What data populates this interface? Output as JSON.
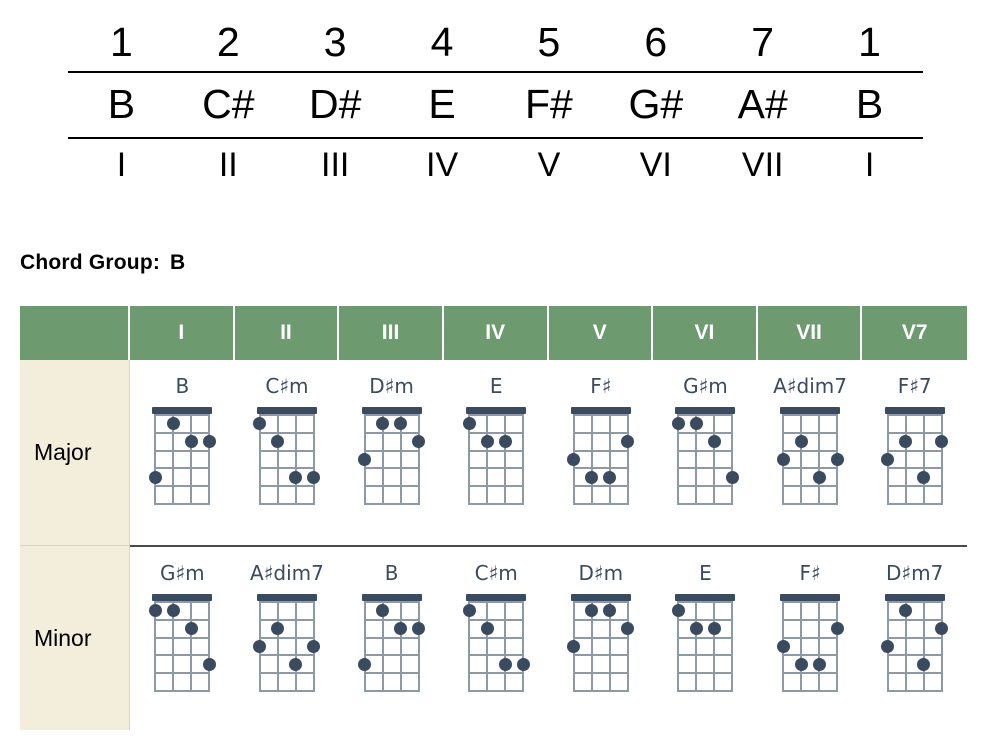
{
  "scale_table": {
    "degrees_label": "scale degrees",
    "degrees": [
      "1",
      "2",
      "3",
      "4",
      "5",
      "6",
      "7",
      "1"
    ],
    "notes": [
      "B",
      "C#",
      "D#",
      "E",
      "F#",
      "G#",
      "A#",
      "B"
    ],
    "numerals": [
      "I",
      "II",
      "III",
      "IV",
      "V",
      "VI",
      "VII",
      "I"
    ]
  },
  "chord_group": {
    "label": "Chord Group:",
    "value": "B"
  },
  "chord_table": {
    "header_accent_color": "#6E9A70",
    "row_label_color": "#F3EEDC",
    "diagram_color": "#3B4B5F",
    "corner_label": "",
    "columns": [
      "I",
      "II",
      "III",
      "IV",
      "V",
      "VI",
      "VII",
      "V7"
    ],
    "rows": [
      {
        "label": "Major",
        "chords": [
          {
            "name": "B",
            "dots": [
              [
                2,
                1
              ],
              [
                3,
                2
              ],
              [
                4,
                2
              ],
              [
                1,
                4
              ]
            ]
          },
          {
            "name": "C♯m",
            "dots": [
              [
                1,
                1
              ],
              [
                2,
                2
              ],
              [
                3,
                4
              ],
              [
                4,
                4
              ]
            ]
          },
          {
            "name": "D♯m",
            "dots": [
              [
                2,
                1
              ],
              [
                3,
                1
              ],
              [
                4,
                2
              ],
              [
                1,
                3
              ]
            ]
          },
          {
            "name": "E",
            "dots": [
              [
                1,
                1
              ],
              [
                2,
                2
              ],
              [
                3,
                2
              ]
            ]
          },
          {
            "name": "F♯",
            "dots": [
              [
                4,
                2
              ],
              [
                1,
                3
              ],
              [
                2,
                4
              ],
              [
                3,
                4
              ]
            ]
          },
          {
            "name": "G♯m",
            "dots": [
              [
                1,
                1
              ],
              [
                2,
                1
              ],
              [
                3,
                2
              ],
              [
                4,
                4
              ]
            ]
          },
          {
            "name": "A♯dim7",
            "dots": [
              [
                2,
                2
              ],
              [
                1,
                3
              ],
              [
                4,
                3
              ],
              [
                3,
                4
              ]
            ]
          },
          {
            "name": "F♯7",
            "dots": [
              [
                2,
                2
              ],
              [
                4,
                2
              ],
              [
                1,
                3
              ],
              [
                3,
                4
              ]
            ]
          }
        ]
      },
      {
        "label": "Minor",
        "chords": [
          {
            "name": "G♯m",
            "dots": [
              [
                1,
                1
              ],
              [
                2,
                1
              ],
              [
                3,
                2
              ],
              [
                4,
                4
              ]
            ]
          },
          {
            "name": "A♯dim7",
            "dots": [
              [
                2,
                2
              ],
              [
                1,
                3
              ],
              [
                4,
                3
              ],
              [
                3,
                4
              ]
            ]
          },
          {
            "name": "B",
            "dots": [
              [
                2,
                1
              ],
              [
                3,
                2
              ],
              [
                4,
                2
              ],
              [
                1,
                4
              ]
            ]
          },
          {
            "name": "C♯m",
            "dots": [
              [
                1,
                1
              ],
              [
                2,
                2
              ],
              [
                3,
                4
              ],
              [
                4,
                4
              ]
            ]
          },
          {
            "name": "D♯m",
            "dots": [
              [
                2,
                1
              ],
              [
                3,
                1
              ],
              [
                4,
                2
              ],
              [
                1,
                3
              ]
            ]
          },
          {
            "name": "E",
            "dots": [
              [
                1,
                1
              ],
              [
                2,
                2
              ],
              [
                3,
                2
              ]
            ]
          },
          {
            "name": "F♯",
            "dots": [
              [
                4,
                2
              ],
              [
                1,
                3
              ],
              [
                2,
                4
              ],
              [
                3,
                4
              ]
            ]
          },
          {
            "name": "D♯m7",
            "dots": [
              [
                2,
                1
              ],
              [
                4,
                2
              ],
              [
                1,
                3
              ],
              [
                3,
                4
              ]
            ]
          }
        ]
      }
    ]
  }
}
